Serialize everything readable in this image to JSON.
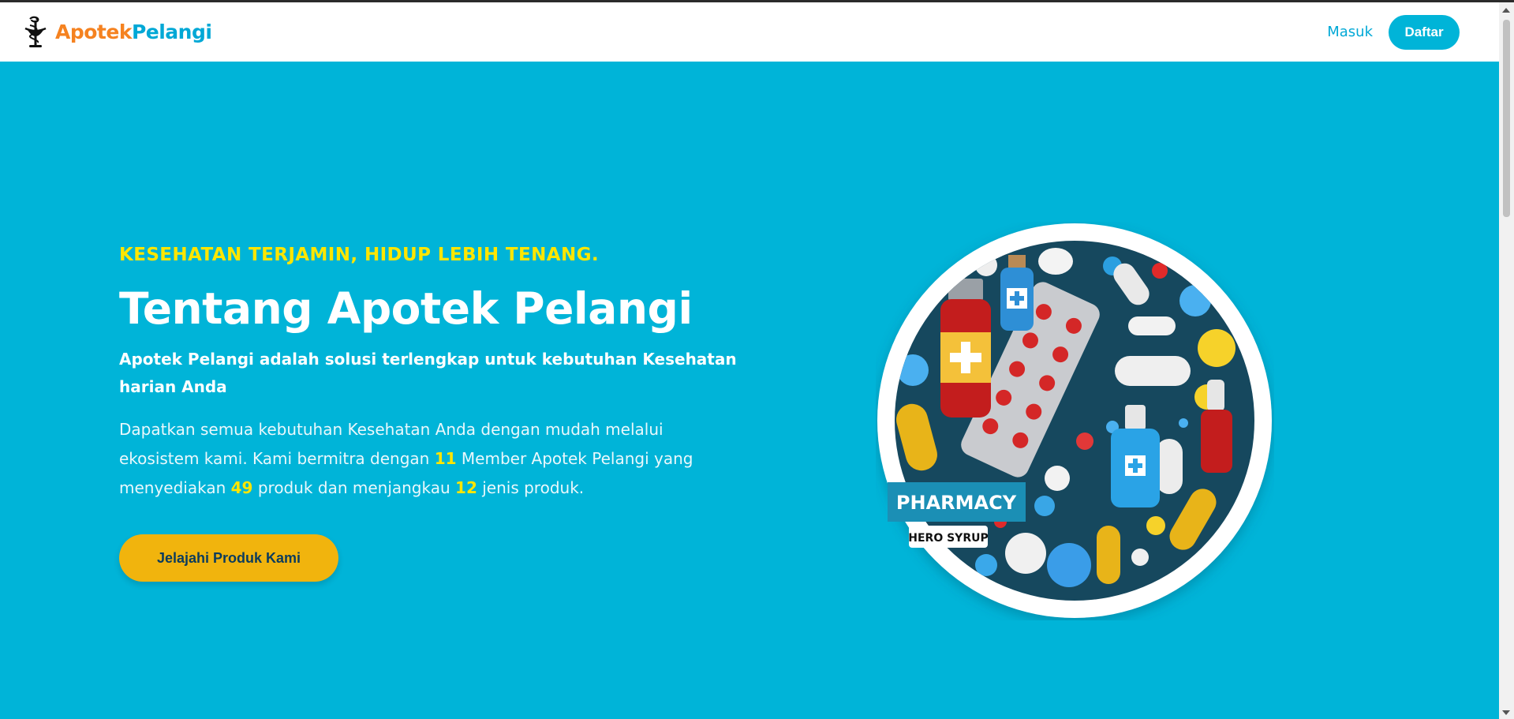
{
  "navbar": {
    "logo_icon": "caduceus-icon",
    "brand_part1": "Apotek",
    "brand_part2": "Pelangi",
    "login_label": "Masuk",
    "register_label": "Daftar"
  },
  "hero": {
    "tagline": "KESEHATAN TERJAMIN, HIDUP LEBIH TENANG.",
    "title": "Tentang Apotek Pelangi",
    "subtitle": "Apotek Pelangi adalah solusi terlengkap untuk kebutuhan Kesehatan harian Anda",
    "desc_part1": "Dapatkan semua kebutuhan Kesehatan Anda dengan mudah melalui ekosistem kami. Kami bermitra dengan",
    "member_count": "11",
    "desc_part2": "Member Apotek Pelangi yang menyediakan",
    "product_count": "49",
    "desc_part3": "produk dan menjangkau",
    "category_count": "12",
    "desc_part4": "jenis produk.",
    "cta_label": "Jelajahi Produk Kami",
    "image_badge_title": "PHARMACY",
    "image_badge_sub": "HERO SYRUP"
  },
  "colors": {
    "primary": "#00b4d8",
    "accent_yellow": "#ffe600",
    "cta": "#f1b40d",
    "brand_orange": "#f58220"
  }
}
